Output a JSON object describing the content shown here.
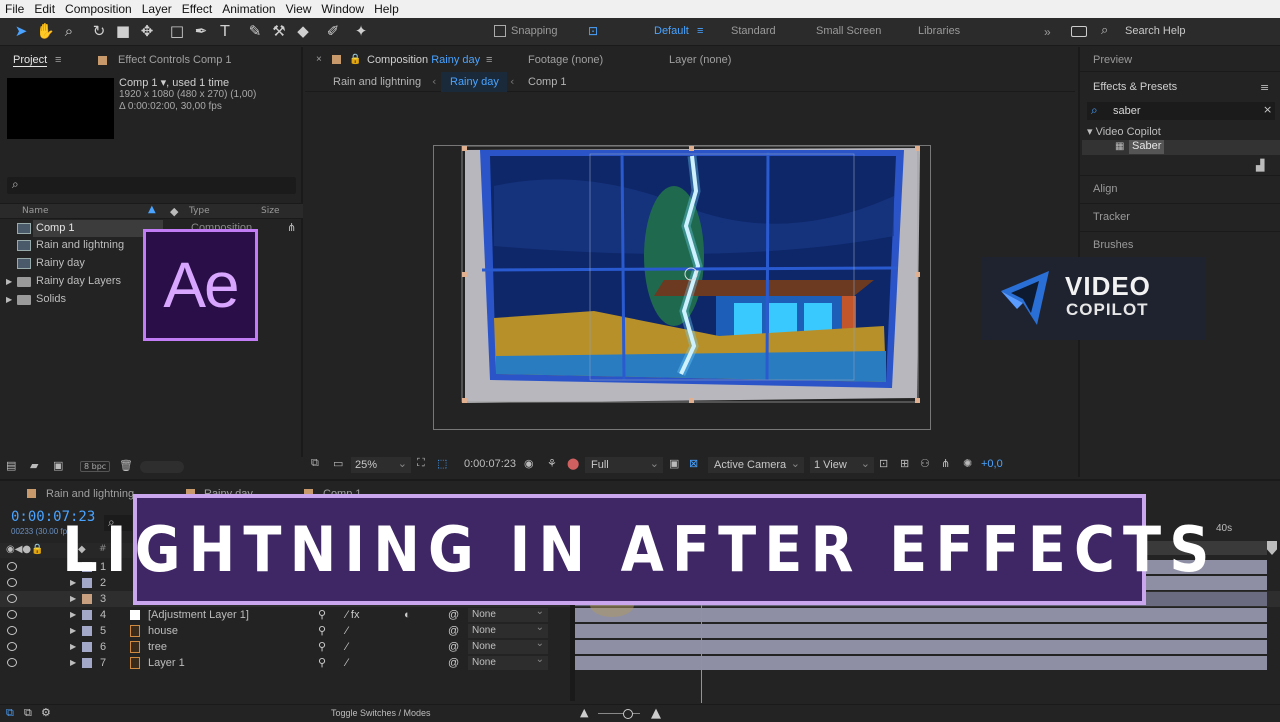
{
  "menu": [
    "File",
    "Edit",
    "Composition",
    "Layer",
    "Effect",
    "Animation",
    "View",
    "Window",
    "Help"
  ],
  "toolbar": {
    "snapping_label": "Snapping",
    "workspaces": [
      "Default",
      "Standard",
      "Small Screen",
      "Libraries"
    ],
    "search_help": "Search Help"
  },
  "project": {
    "tab_label": "Project",
    "effect_controls_label": "Effect Controls Comp 1",
    "comp_name": "Comp 1",
    "comp_used": ", used 1 time",
    "comp_res": "1920 x 1080  (480 x 270) (1,00)",
    "comp_duration": "Δ 0:00:02:00, 30,00 fps",
    "search_icon_label": "⌕",
    "col_name": "Name",
    "col_type": "Type",
    "col_size": "Size",
    "items": [
      {
        "name": "Comp 1",
        "type": "Composition"
      },
      {
        "name": "Rain and lightning",
        "type": ""
      },
      {
        "name": "Rainy day",
        "type": ""
      },
      {
        "name": "Rainy day Layers",
        "type": ""
      },
      {
        "name": "Solids",
        "type": ""
      }
    ],
    "bpc": "8 bpc"
  },
  "ae_logo": "Ae",
  "composition": {
    "tab_label": "Composition",
    "tab_comp": "Rainy day",
    "footage_label": "Footage (none)",
    "layer_label": "Layer (none)",
    "breadcrumbs": [
      "Rain and lightning",
      "Rainy day",
      "Comp 1"
    ],
    "zoom": "25%",
    "timecode": "0:00:07:23",
    "resolution": "Full",
    "camera": "Active Camera",
    "view": "1 View",
    "exposure": "+0,0"
  },
  "right_panel": {
    "preview": "Preview",
    "effects_presets": "Effects & Presets",
    "search_value": "saber",
    "folder": "Video Copilot",
    "effect": "Saber",
    "items": [
      "Align",
      "Tracker",
      "Brushes"
    ]
  },
  "vc_logo": {
    "line1": "VIDEO",
    "line2": "COPILOT"
  },
  "timeline": {
    "tabs": [
      "Rain and lightning",
      "Rainy day",
      "Comp 1"
    ],
    "timecode": "0:00:07:23",
    "frames": "00233 (30.00 fps)",
    "ruler_label": "40s",
    "ruler_label_left": "s",
    "layers": [
      {
        "num": "1",
        "name": "",
        "mode": ""
      },
      {
        "num": "2",
        "name": "",
        "mode": ""
      },
      {
        "num": "3",
        "name": "",
        "mode": ""
      },
      {
        "num": "4",
        "name": "[Adjustment Layer 1]",
        "mode": "None"
      },
      {
        "num": "5",
        "name": "house",
        "mode": "None"
      },
      {
        "num": "6",
        "name": "tree",
        "mode": "None"
      },
      {
        "num": "7",
        "name": "Layer 1",
        "mode": "None"
      }
    ],
    "toggle_label": "Toggle Switches / Modes"
  },
  "banner": {
    "title": "LIGHTNING IN AFTER EFFECTS"
  },
  "colors": {
    "accent_blue": "#2d8ceb",
    "ae_purple": "#2a0e48",
    "ae_border": "#c27cf5",
    "banner_bg": "#3f2765",
    "banner_border": "#c9a6ee"
  }
}
